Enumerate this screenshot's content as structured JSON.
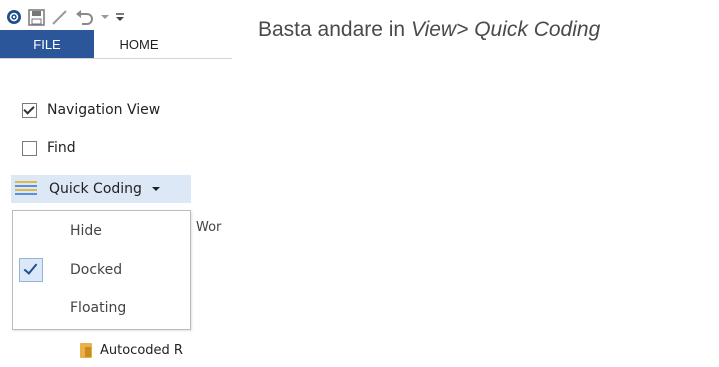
{
  "toolbar": {
    "icons": [
      "app-logo-icon",
      "save-icon",
      "edit-icon",
      "undo-icon",
      "dropdown-icon",
      "customize-toolbar-icon"
    ]
  },
  "ribbon": {
    "tabs": [
      {
        "label": "FILE",
        "active": true
      },
      {
        "label": "HOME",
        "active": false
      }
    ],
    "navigation_view": {
      "label": "Navigation View",
      "checked": true
    },
    "find": {
      "label": "Find",
      "checked": false
    },
    "quick_coding": {
      "label": "Quick Coding",
      "icon": "quick-coding-icon"
    },
    "group_hint": "Wor"
  },
  "dropdown": {
    "items": [
      {
        "label": "Hide",
        "checked": false
      },
      {
        "label": "Docked",
        "checked": true
      },
      {
        "label": "Floating",
        "checked": false
      }
    ]
  },
  "tree": {
    "item_label": "Autocoded R",
    "item_icon": "folder-icon"
  },
  "caption": {
    "prefix": "Basta andare in ",
    "path_view": "View",
    "separator": "> ",
    "path_quick_coding": "Quick Coding"
  },
  "colors": {
    "file_tab_bg": "#2b579a",
    "hover_bg": "#dce8f6",
    "check_accent": "#1e4f9a",
    "caption_text": "#4a4a4a"
  }
}
